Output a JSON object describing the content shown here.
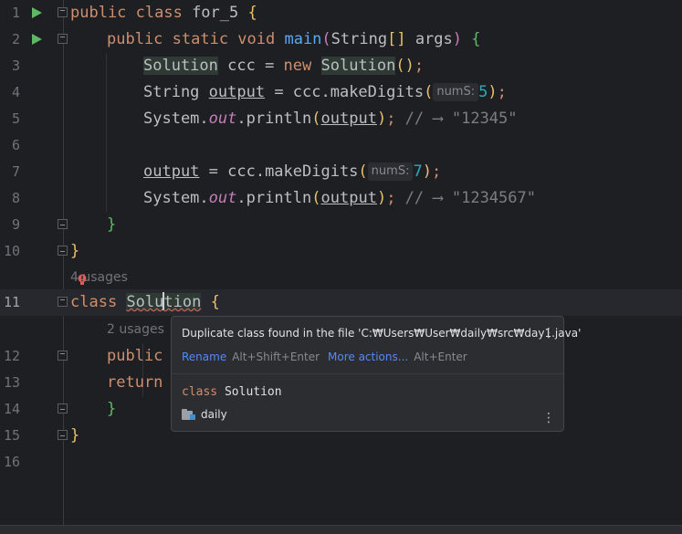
{
  "editor": {
    "line_numbers": [
      "1",
      "2",
      "3",
      "4",
      "5",
      "6",
      "7",
      "8",
      "9",
      "10",
      "11",
      "12",
      "13",
      "14",
      "15",
      "16"
    ],
    "code": {
      "l1": {
        "kw": "public class ",
        "name": "for_5 ",
        "brace": "{"
      },
      "l2": {
        "kw": "public static void ",
        "fn": "main",
        "p1": "(",
        "type": "String",
        "arr": "[]",
        "args": " args",
        "p2": ")",
        "sp": " ",
        "brace": "{"
      },
      "l3": {
        "type": "Solution",
        "mid": " ccc = ",
        "new": "new ",
        "type2": "Solution",
        "p": "()",
        "semi": ";"
      },
      "l4": {
        "type": "String ",
        "var": "output",
        "mid": " = ccc.makeDigits",
        "p1": "(",
        "hint": "numS:",
        "num": "5",
        "p2": ")",
        "semi": ";"
      },
      "l5": {
        "pre": "System.",
        "stat": "out",
        "mid": ".println",
        "p1": "(",
        "var": "output",
        "p2": ")",
        "semi": "; ",
        "comment": "// ⟶ ",
        "str": "\"12345\""
      },
      "l7": {
        "var": "output",
        "mid": " = ccc.makeDigits",
        "p1": "(",
        "hint": "numS:",
        "num": "7",
        "p2": ")",
        "semi": ";"
      },
      "l8": {
        "pre": "System.",
        "stat": "out",
        "mid": ".println",
        "p1": "(",
        "var": "output",
        "p2": ")",
        "semi": "; ",
        "comment": "// ⟶ ",
        "str": "\"1234567\""
      },
      "l9": {
        "brace": "}"
      },
      "l10": {
        "brace": "}"
      },
      "l11": {
        "kw": "class ",
        "name_a": "Solu",
        "name_b": "tion",
        "sp": " ",
        "brace": "{"
      },
      "l12": {
        "kw": "public"
      },
      "l13": {
        "kw": "return"
      },
      "l14": {
        "brace": "}"
      },
      "l15": {
        "brace": "}"
      }
    },
    "usages_class": "4 usages",
    "usages_method": "2 usages"
  },
  "popup": {
    "message": "Duplicate class found in the file 'C:₩Users₩User₩daily₩src₩day1.java'",
    "rename_label": "Rename",
    "rename_shortcut": "Alt+Shift+Enter",
    "more_actions_label": "More actions...",
    "more_actions_shortcut": "Alt+Enter",
    "decl_kw": "class",
    "decl_name": "Solution",
    "package": "daily",
    "more_icon": "⋮"
  },
  "colors": {
    "background": "#1e1f22",
    "keyword": "#cf8e6d",
    "method": "#57aaf7",
    "number": "#2aacb8",
    "string": "#6aab73",
    "link": "#548af7",
    "run": "#5fb865"
  }
}
